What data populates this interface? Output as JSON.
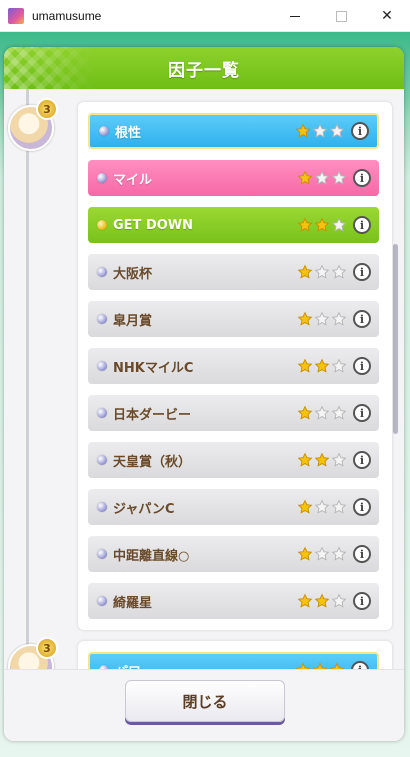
{
  "window": {
    "title": "umamusume",
    "close_glyph": "✕"
  },
  "dialog": {
    "title": "因子一覧",
    "close_button": "閉じる"
  },
  "groups": [
    {
      "badge": "3",
      "factors": [
        {
          "name": "根性",
          "color": "blue",
          "stars": 1,
          "dot": "silver"
        },
        {
          "name": "マイル",
          "color": "pink",
          "stars": 1,
          "dot": "silver"
        },
        {
          "name": "GET DOWN",
          "color": "green",
          "stars": 2,
          "dot": "gold"
        },
        {
          "name": "大阪杯",
          "color": "gray",
          "stars": 1,
          "dot": "silver"
        },
        {
          "name": "皐月賞",
          "color": "gray",
          "stars": 1,
          "dot": "silver"
        },
        {
          "name": "NHKマイルC",
          "color": "gray",
          "stars": 2,
          "dot": "silver"
        },
        {
          "name": "日本ダービー",
          "color": "gray",
          "stars": 1,
          "dot": "silver"
        },
        {
          "name": "天皇賞（秋）",
          "color": "gray",
          "stars": 2,
          "dot": "silver"
        },
        {
          "name": "ジャパンC",
          "color": "gray",
          "stars": 1,
          "dot": "silver"
        },
        {
          "name": "中距離直線○",
          "color": "gray",
          "stars": 1,
          "dot": "silver"
        },
        {
          "name": "綺羅星",
          "color": "gray",
          "stars": 2,
          "dot": "silver"
        }
      ]
    },
    {
      "badge": "3",
      "factors": [
        {
          "name": "パワー",
          "color": "blue",
          "stars": 3,
          "dot": "silver"
        }
      ]
    }
  ],
  "colors": {
    "header_green": "#7cc520",
    "factor_blue": "#3ab8f0",
    "factor_pink": "#f874ae",
    "factor_green": "#86cb26",
    "factor_gray": "#e2e2e5",
    "star_gold": "#f5c20d"
  },
  "icons": {
    "info": "i"
  }
}
